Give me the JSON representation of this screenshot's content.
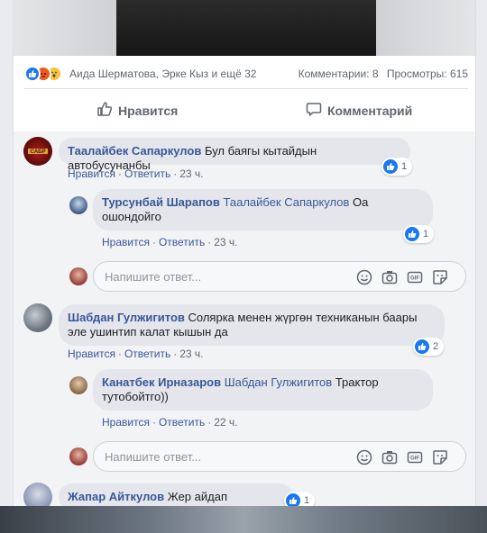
{
  "post": {
    "reactions": [
      "like",
      "angry",
      "wow"
    ],
    "reaction_names": "Аида Шерматова, Эрке Кыз и ещё 32",
    "comments_count": "Комментарии: 8",
    "views_count": "Просмотры: 615",
    "like_label": "Нравится",
    "comment_label": "Комментарий"
  },
  "comments": [
    {
      "author": "Таалайбек Сапаркулов",
      "text": "Бул баягы кытайдын автобусунанбы",
      "like_link": "Нравится",
      "reply_link": "Ответить",
      "time": "23 ч.",
      "likes": "1",
      "replies": [
        {
          "author": "Турсунбай Шарапов",
          "mention": "Таалайбек Сапаркулов",
          "text": "Оа ошондойго",
          "like_link": "Нравится",
          "reply_link": "Ответить",
          "time": "23 ч.",
          "likes": "1"
        }
      ],
      "reply_placeholder": "Напишите ответ..."
    },
    {
      "author": "Шабдан Гулжигитов",
      "text": "Солярка менен жүргөн техниканын баары эле ушинтип калат кышын да",
      "like_link": "Нравится",
      "reply_link": "Ответить",
      "time": "23 ч.",
      "likes": "2",
      "replies": [
        {
          "author": "Канатбек Ирназаров",
          "mention": "Шабдан Гулжигитов",
          "text": "Трактор тутобойтго))",
          "like_link": "Нравится",
          "reply_link": "Ответить",
          "time": "22 ч.",
          "likes": ""
        }
      ],
      "reply_placeholder": "Напишите ответ..."
    },
    {
      "author": "Жапар Айткулов",
      "text": "Жер айдап калыптыр",
      "likes": "1"
    }
  ],
  "colors": {
    "link": "#385898",
    "like_blue": "#1877f2",
    "bubble": "#e4e6eb",
    "meta": "#606770"
  },
  "icons": [
    "like-icon",
    "angry-icon",
    "wow-icon",
    "thumbs-up-icon",
    "comment-icon",
    "emoji-icon",
    "camera-icon",
    "gif-icon",
    "sticker-icon"
  ]
}
